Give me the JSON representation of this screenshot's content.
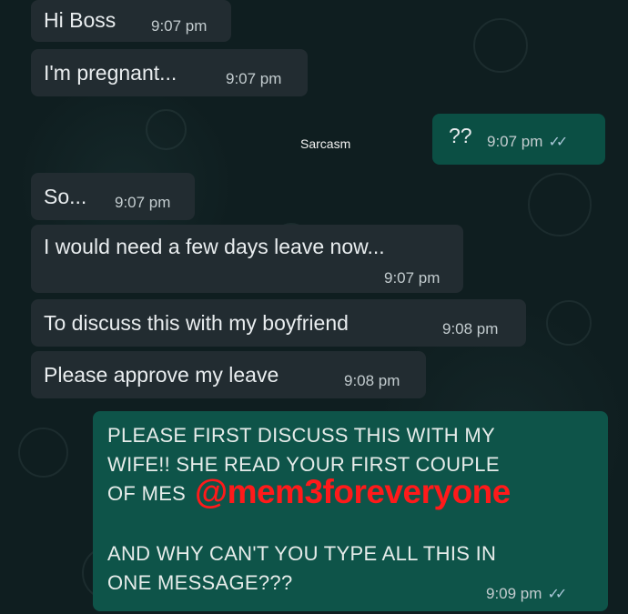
{
  "messages": [
    {
      "text": "Hi Boss",
      "time": "9:07 pm"
    },
    {
      "text": "I'm pregnant...",
      "time": "9:07 pm"
    },
    {
      "text": "??",
      "time": "9:07 pm"
    },
    {
      "text": "So...",
      "time": "9:07 pm"
    },
    {
      "text": "I would need a few days leave now...",
      "time": "9:07 pm"
    },
    {
      "text": "To discuss this with my boyfriend",
      "time": "9:08 pm"
    },
    {
      "text": "Please approve my leave",
      "time": "9:08 pm"
    },
    {
      "lines": [
        "PLEASE FIRST DISCUSS THIS WITH MY",
        "WIFE!! SHE READ YOUR FIRST COUPLE",
        "OF MES",
        "AND WHY CAN'T YOU TYPE ALL THIS IN",
        "ONE MESSAGE???"
      ],
      "time": "9:09 pm"
    }
  ],
  "center_label": "Sarcasm",
  "watermark": "@mem3foreveryone",
  "ticks": "✓✓",
  "colors": {
    "background": "#0f1e20",
    "incoming": "#222c31",
    "outgoing": "#0b4f44",
    "watermark": "#ff1a1a"
  }
}
